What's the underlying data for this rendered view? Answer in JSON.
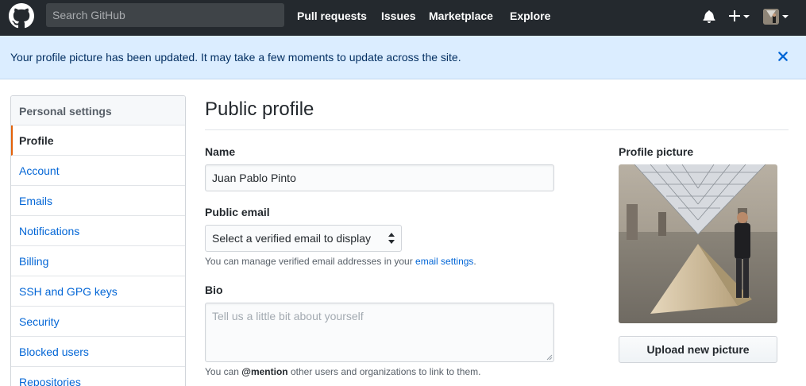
{
  "header": {
    "search_placeholder": "Search GitHub",
    "nav": [
      "Pull requests",
      "Issues",
      "Marketplace",
      "Explore"
    ],
    "icons": {
      "logo": "github-logo-icon",
      "notifications": "bell-icon",
      "create": "plus-icon",
      "avatar": "user-avatar"
    }
  },
  "flash": {
    "message": "Your profile picture has been updated. It may take a few moments to update across the site."
  },
  "sidebar": {
    "heading": "Personal settings",
    "items": [
      {
        "label": "Profile",
        "selected": true
      },
      {
        "label": "Account",
        "selected": false
      },
      {
        "label": "Emails",
        "selected": false
      },
      {
        "label": "Notifications",
        "selected": false
      },
      {
        "label": "Billing",
        "selected": false
      },
      {
        "label": "SSH and GPG keys",
        "selected": false
      },
      {
        "label": "Security",
        "selected": false
      },
      {
        "label": "Blocked users",
        "selected": false
      },
      {
        "label": "Repositories",
        "selected": false
      }
    ]
  },
  "main": {
    "title": "Public profile",
    "name": {
      "label": "Name",
      "value": "Juan Pablo Pinto"
    },
    "public_email": {
      "label": "Public email",
      "selected": "Select a verified email to display",
      "note_prefix": "You can manage verified email addresses in your ",
      "note_link": "email settings",
      "note_suffix": "."
    },
    "bio": {
      "label": "Bio",
      "placeholder": "Tell us a little bit about yourself",
      "note_prefix": "You can ",
      "note_mention": "@mention",
      "note_suffix": " other users and organizations to link to them."
    },
    "profile_picture": {
      "label": "Profile picture",
      "upload_label": "Upload new picture"
    }
  },
  "colors": {
    "header_bg": "#24292e",
    "flash_bg": "#dbedff",
    "link": "#0366d6",
    "selected_accent": "#e36209"
  }
}
